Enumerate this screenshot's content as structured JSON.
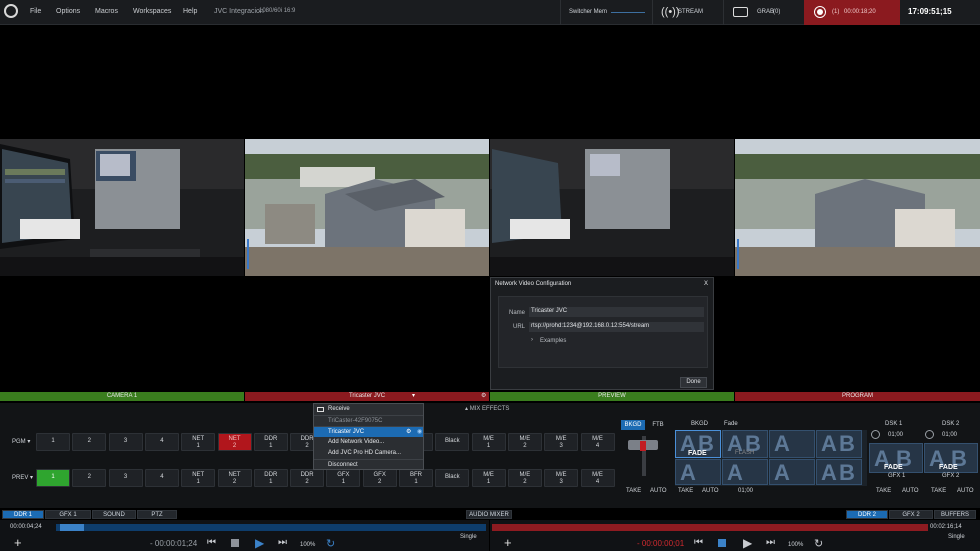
{
  "menubar": {
    "items": [
      "File",
      "Options",
      "Macros",
      "Workspaces",
      "Help"
    ],
    "session_name": "JVC Integracion",
    "format": "1080/60i 16:9",
    "switcher_mem": "Switcher Mem",
    "stream_label": "STREAM",
    "grab_label": "GRAB",
    "grab_count": "(0)",
    "record_count": "(1)",
    "record_time": "00:00:18;20",
    "clock": "17:09:51;15"
  },
  "labels": {
    "camera1": "CAMERA 1",
    "tricaster": "Tricaster JVC",
    "preview": "PREVIEW",
    "program": "PROGRAM",
    "mix_effects": "MIX EFFECTS"
  },
  "dialog": {
    "title": "Network Video Configuration",
    "close": "X",
    "name_label": "Name",
    "name_value": "Tricaster JVC",
    "url_label": "URL",
    "url_value": "rtsp://prohd:1234@192.168.0.12:554/stream",
    "examples": "Examples",
    "done": "Done"
  },
  "context_menu": {
    "receive": "Receive",
    "source_id": "TriCaster-42F9075C",
    "selected": "Tricaster JVC",
    "add_network": "Add Network Video...",
    "add_jvc": "Add JVC Pro HD Camera...",
    "disconnect": "Disconnect"
  },
  "pgm": {
    "label": "PGM",
    "buttons": [
      [
        "1",
        ""
      ],
      [
        "2",
        ""
      ],
      [
        "3",
        ""
      ],
      [
        "4",
        ""
      ],
      [
        "NET",
        "1"
      ],
      [
        "NET",
        "2"
      ],
      [
        "DDR",
        "1"
      ],
      [
        "DDR",
        "2"
      ],
      [
        "GFX",
        "1"
      ],
      [
        "GFX",
        "2"
      ],
      [
        "BFR",
        "1"
      ],
      [
        "Black",
        ""
      ],
      [
        "M/E",
        "1"
      ],
      [
        "M/E",
        "2"
      ],
      [
        "M/E",
        "3"
      ],
      [
        "M/E",
        "4"
      ]
    ]
  },
  "prev": {
    "label": "PREV",
    "buttons": [
      [
        "1",
        ""
      ],
      [
        "2",
        ""
      ],
      [
        "3",
        ""
      ],
      [
        "4",
        ""
      ],
      [
        "NET",
        "1"
      ],
      [
        "NET",
        "2"
      ],
      [
        "DDR",
        "1"
      ],
      [
        "DDR",
        "2"
      ],
      [
        "GFX",
        "1"
      ],
      [
        "GFX",
        "2"
      ],
      [
        "BFR",
        "1"
      ],
      [
        "Black",
        ""
      ],
      [
        "M/E",
        "1"
      ],
      [
        "M/E",
        "2"
      ],
      [
        "M/E",
        "3"
      ],
      [
        "M/E",
        "4"
      ]
    ]
  },
  "transition": {
    "bkgd": "BKGD",
    "ftb": "FTB",
    "take": "TAKE",
    "auto": "AUTO",
    "bkgd_head": "BKGD",
    "fade_head": "Fade",
    "fade": "FADE",
    "flash": "FLASH",
    "duration": "01;00",
    "dsk1": "DSK 1",
    "dsk2": "DSK 2",
    "dsk_dur1": "01;00",
    "dsk_dur2": "01;00",
    "gfx1": "GFX 1",
    "gfx2": "GFX 2"
  },
  "tabs": {
    "left": [
      "DDR 1",
      "GFX 1",
      "SOUND",
      "PTZ"
    ],
    "audio_mixer": "AUDIO MIXER",
    "right": [
      "DDR 2",
      "GFX 2",
      "BUFFERS"
    ]
  },
  "ddr1": {
    "clip_time": "00:00:04;24",
    "remaining": "- 00:00:01;24",
    "speed": "100%",
    "single": "Single"
  },
  "ddr2": {
    "clip_time": "00:02:16;14",
    "remaining": "- 00:00:00;01",
    "speed": "100%",
    "single": "Single"
  },
  "colors": {
    "accent_blue": "#1c6bb3",
    "program_red": "#8b1a1f",
    "preview_green": "#3a7d1e"
  }
}
